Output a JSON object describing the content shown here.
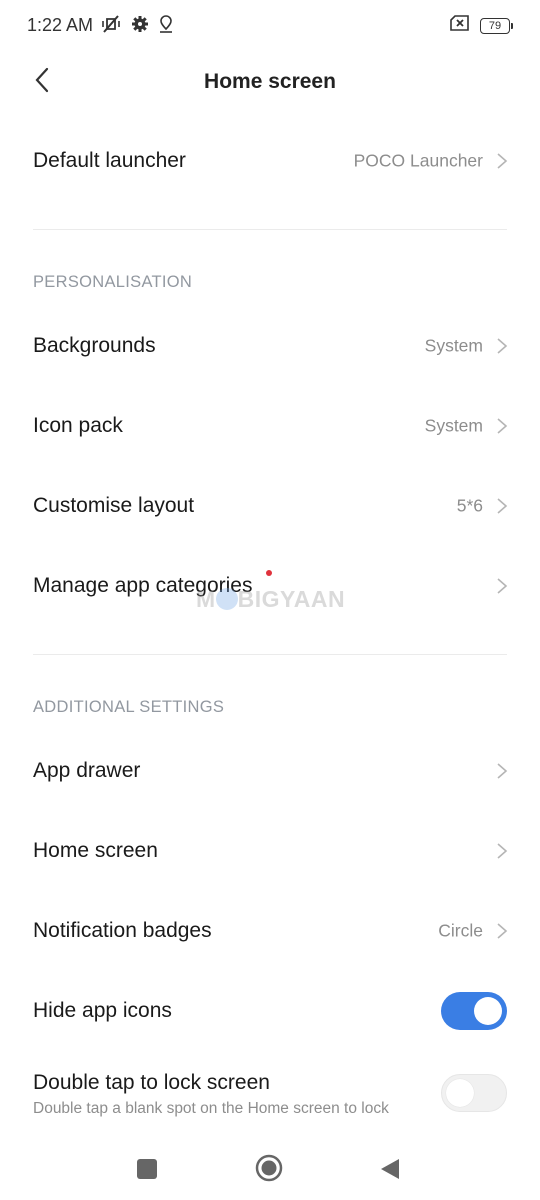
{
  "status_bar": {
    "time": "1:22 AM",
    "icons_left": [
      "vibrate-off-icon",
      "settings-gear-icon",
      "location-icon"
    ],
    "icons_right": [
      "no-sim-icon",
      "battery-icon"
    ],
    "battery_level": "79"
  },
  "header": {
    "title": "Home screen",
    "back_icon": "chevron-left-icon"
  },
  "rows": {
    "default_launcher": {
      "label": "Default launcher",
      "value": "POCO Launcher"
    },
    "backgrounds": {
      "label": "Backgrounds",
      "value": "System"
    },
    "icon_pack": {
      "label": "Icon pack",
      "value": "System"
    },
    "customise_layout": {
      "label": "Customise layout",
      "value": "5*6"
    },
    "manage_app_categories": {
      "label": "Manage app categories",
      "value": "",
      "has_new_badge": true
    },
    "app_drawer": {
      "label": "App drawer",
      "value": ""
    },
    "home_screen": {
      "label": "Home screen",
      "value": ""
    },
    "notification_badges": {
      "label": "Notification badges",
      "value": "Circle"
    },
    "hide_app_icons": {
      "label": "Hide app icons",
      "toggle": true
    },
    "double_tap_lock": {
      "label": "Double tap to lock screen",
      "description": "Double tap a blank spot on the Home screen to lock",
      "toggle": false
    }
  },
  "sections": {
    "personalisation": "PERSONALISATION",
    "additional_settings": "ADDITIONAL SETTINGS"
  },
  "watermark": {
    "text_prefix": "M",
    "text_suffix": "BIGYAAN"
  },
  "navbar": {
    "buttons": [
      "recents-square-icon",
      "home-circle-icon",
      "back-triangle-icon"
    ]
  },
  "colors": {
    "accent": "#3a7ee4",
    "badge_dot": "#e0323c",
    "secondary_text": "#8d8d8d",
    "section_header": "#9298a0"
  }
}
